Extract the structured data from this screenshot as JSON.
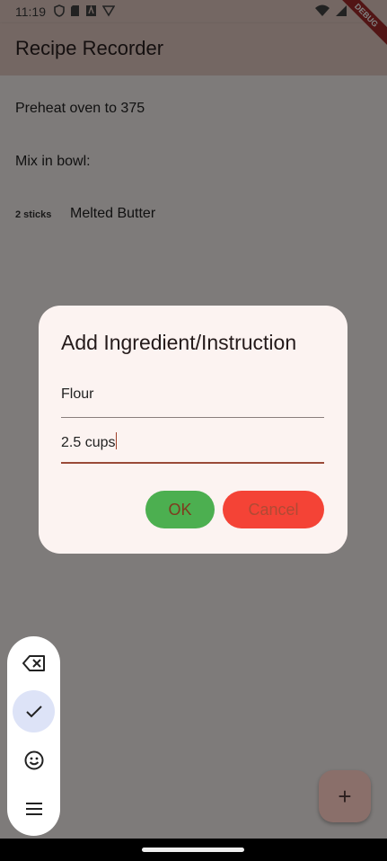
{
  "status": {
    "time": "11:19"
  },
  "app": {
    "title": "Recipe Recorder",
    "debug_banner": "DEBUG"
  },
  "steps": [
    {
      "text": "Preheat oven to 375"
    },
    {
      "text": "Mix in bowl:"
    },
    {
      "quantity": "2 sticks",
      "text": "Melted Butter"
    }
  ],
  "dialog": {
    "title": "Add Ingredient/Instruction",
    "name_value": "Flour",
    "amount_value": "2.5 cups",
    "ok_label": "OK",
    "cancel_label": "Cancel"
  },
  "fab": {
    "icon": "plus-icon",
    "label": "+"
  },
  "keyboard_toolbar": {
    "items": [
      "backspace-icon",
      "check-icon",
      "emoji-icon",
      "menu-icon"
    ],
    "active": "check-icon"
  },
  "colors": {
    "ok": "#4caf50",
    "cancel": "#f44336",
    "appbar": "#e8cfc7"
  }
}
